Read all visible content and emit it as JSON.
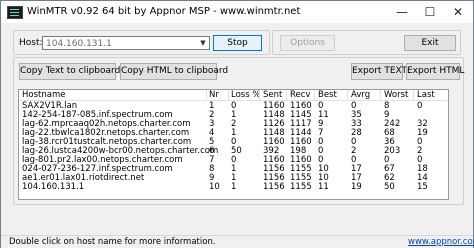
{
  "window": {
    "title": "WinMTR v0.92 64 bit by Appnor MSP - www.winmtr.net",
    "minimize": "—",
    "maximize": "☐",
    "close": "✕"
  },
  "host": {
    "label": "Host:",
    "value": "104.160.131.1",
    "stop_label": "Stop",
    "options_label": "Options",
    "exit_label": "Exit"
  },
  "actions": {
    "copy_text": "Copy Text to clipboard",
    "copy_html": "Copy HTML to clipboard",
    "export_text": "Export TEXT",
    "export_html": "Export HTML"
  },
  "table": {
    "columns": [
      "Hostname",
      "Nr",
      "Loss %",
      "Sent",
      "Recv",
      "Best",
      "Avrg",
      "Worst",
      "Last"
    ],
    "rows": [
      [
        "SAX2V1R.lan",
        "1",
        "0",
        "1160",
        "1160",
        "0",
        "0",
        "8",
        "0"
      ],
      [
        "142-254-187-085.inf.spectrum.com",
        "2",
        "1",
        "1148",
        "1145",
        "11",
        "35",
        "9",
        ""
      ],
      [
        "lag-62.mprcaaq02h.netops.charter.com",
        "3",
        "2",
        "1126",
        "1117",
        "9",
        "33",
        "242",
        "32"
      ],
      [
        "lag-22.tbwlca1802r.netops.charter.com",
        "4",
        "1",
        "1148",
        "1144",
        "7",
        "28",
        "68",
        "19"
      ],
      [
        "lag-38.rcr01tustcalt.netops.charter.com",
        "5",
        "0",
        "1160",
        "1160",
        "0",
        "0",
        "36",
        "0"
      ],
      [
        "lag-26.lustca4200w-bcr00.netops.charter.com",
        "6",
        "50",
        "392",
        "198",
        "0",
        "2",
        "203",
        "2"
      ],
      [
        "lag-801.pr2.lax00.netops.charter.com",
        "7",
        "0",
        "1160",
        "1160",
        "0",
        "0",
        "0",
        "0"
      ],
      [
        "024-027-236-127.inf.spectrum.com",
        "8",
        "1",
        "1156",
        "1155",
        "10",
        "17",
        "67",
        "18"
      ],
      [
        "ae1.er01.lax01.riotdirect.net",
        "9",
        "1",
        "1156",
        "1155",
        "10",
        "17",
        "62",
        "14"
      ],
      [
        "104.160.131.1",
        "10",
        "1",
        "1156",
        "1155",
        "11",
        "19",
        "50",
        "15"
      ]
    ]
  },
  "status": {
    "hint": "Double click on host name for more information.",
    "link": "www.appnor.com"
  }
}
